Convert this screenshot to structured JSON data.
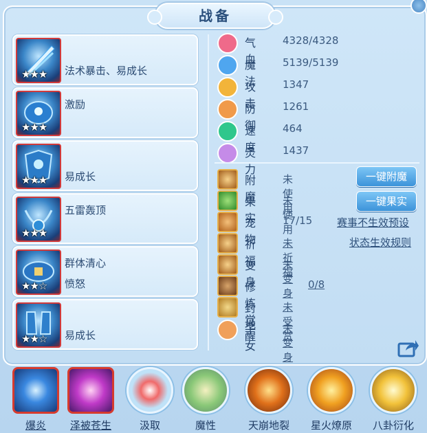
{
  "title": "战备",
  "equipment": [
    {
      "line1": "",
      "line2": "法术暴击、易成长",
      "stars": "★★★"
    },
    {
      "line1": "激励",
      "line2": "",
      "stars": "★★★"
    },
    {
      "line1": "",
      "line2": "易成长",
      "stars": "★★★"
    },
    {
      "line1": "五雷轰顶",
      "line2": "",
      "stars": "★★★"
    },
    {
      "line1": "群体清心",
      "line2": "愤怒",
      "stars": "★★☆"
    },
    {
      "line1": "",
      "line2": "易成长",
      "stars": "★★☆"
    }
  ],
  "stats": [
    {
      "name": "气血",
      "value": "4328/4328",
      "icon": "heart-icon",
      "color": "#ef6a8a"
    },
    {
      "name": "魔法",
      "value": "5139/5139",
      "icon": "mana-icon",
      "color": "#4fa6ef"
    },
    {
      "name": "攻击",
      "value": "1347",
      "icon": "sword-icon",
      "color": "#f2b43a"
    },
    {
      "name": "防御",
      "value": "1261",
      "icon": "shield-icon",
      "color": "#f09a4a"
    },
    {
      "name": "速度",
      "value": "464",
      "icon": "lightning-icon",
      "color": "#2fc78c"
    },
    {
      "name": "灵力",
      "value": "1437",
      "icon": "spirit-icon",
      "color": "#c58be8"
    }
  ],
  "extras": [
    {
      "name": "附魔",
      "value": "未使用",
      "underline": false
    },
    {
      "name": "果实",
      "value": "未使用",
      "underline": false
    },
    {
      "name": "宠物",
      "value": "17/15",
      "underline": false
    },
    {
      "name": "祈福",
      "value": "未祈福",
      "underline": true
    },
    {
      "name": "变身",
      "value": "未变身",
      "underline": true
    },
    {
      "name": "修炼觉醒",
      "value": "0/8",
      "underline": true
    },
    {
      "name": "封地",
      "value": "未受赏",
      "underline": true
    },
    {
      "name": "子女",
      "value": "未变身",
      "underline": true
    }
  ],
  "buttons": {
    "enchant": "一键附魔",
    "fruit": "一键果实"
  },
  "links": {
    "event_preset": "赛事不生效预设",
    "status_rules": "状态生效规则"
  },
  "skills": [
    {
      "label": "爆炎",
      "underline": true
    },
    {
      "label": "泽被苍生",
      "underline": true
    },
    {
      "label": "汲取",
      "underline": false
    },
    {
      "label": "魔性",
      "underline": false
    },
    {
      "label": "天崩地裂",
      "underline": false
    },
    {
      "label": "星火燎原",
      "underline": false
    },
    {
      "label": "八卦衍化",
      "underline": false
    }
  ]
}
